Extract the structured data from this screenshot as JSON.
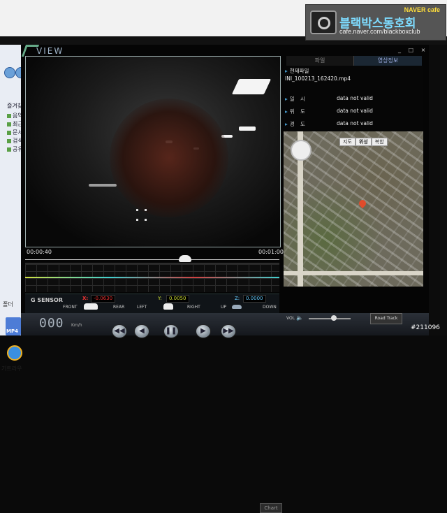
{
  "watermark": {
    "naver_cafe": "NAVER cafe",
    "club_name": "블랙박스동호회",
    "url": "cafe.naver.com/blackboxclub"
  },
  "app": {
    "logo_text": "VIEW"
  },
  "left_panel": {
    "items": [
      "즐겨찾기",
      "음악",
      "최근에",
      "문서",
      "검색",
      "공유"
    ],
    "folder_label": "폴더",
    "mp4_label": "MP4",
    "desktop_label": "기트라우"
  },
  "video": {
    "time_start": "00:00:40",
    "time_end": "00:01:00",
    "seek_fraction": 0.63
  },
  "graph": {
    "button_label": "Chart"
  },
  "gsensor": {
    "label": "G SENSOR",
    "x_label": "X:",
    "x_value": "-0.0630",
    "y_label": "Y:",
    "y_value": "0.0050",
    "z_label": "Z:",
    "z_value": "0.0000",
    "front": "FRONT",
    "rear": "REAR",
    "left": "LEFT",
    "right": "RIGHT",
    "up": "UP",
    "down": "DOWN"
  },
  "controls": {
    "speed": "000",
    "speed_unit": "Km/h",
    "buttons": [
      "prev",
      "rewind",
      "pause",
      "forward",
      "next"
    ]
  },
  "right_panel": {
    "tabs": [
      "파일",
      "영상정보"
    ],
    "active_tab": 1,
    "window_controls": "_ □ ×",
    "current_file_label": "현재파일",
    "file_name": "INI_100213_162420.mp4",
    "rows": [
      {
        "key": "일 시",
        "value": "data not valid"
      },
      {
        "key": "위 도",
        "value": "data not valid"
      },
      {
        "key": "경 도",
        "value": "data not valid"
      }
    ]
  },
  "map": {
    "tabs": [
      "지도",
      "위성",
      "복합"
    ],
    "active_tab": 1
  },
  "volume": {
    "label": "VOL",
    "level": 0.6,
    "road_track": "Road Track"
  },
  "frame_number": "#211096"
}
